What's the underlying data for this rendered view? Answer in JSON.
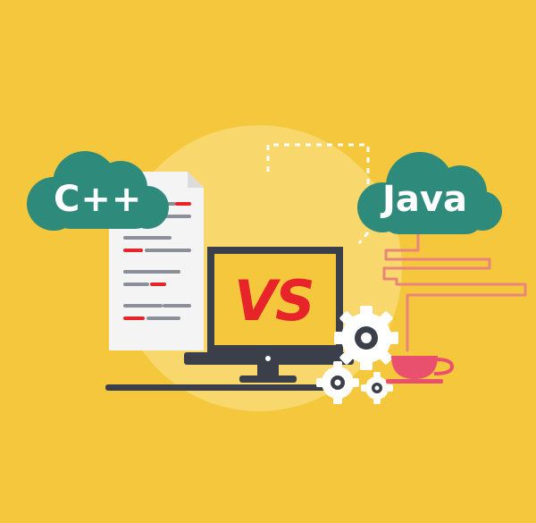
{
  "labels": {
    "left_language": "C++",
    "right_language": "Java",
    "versus": "VS"
  },
  "colors": {
    "background": "#f5c73c",
    "cloud": "#2e8a7a",
    "versus_text": "#e8242b",
    "monitor": "#3b3f4a",
    "cup": "#e9506e",
    "steam_lines": "#e9847a"
  },
  "icons": [
    "cloud-icon",
    "document-icon",
    "monitor-icon",
    "gear-icon",
    "coffee-cup-icon"
  ]
}
